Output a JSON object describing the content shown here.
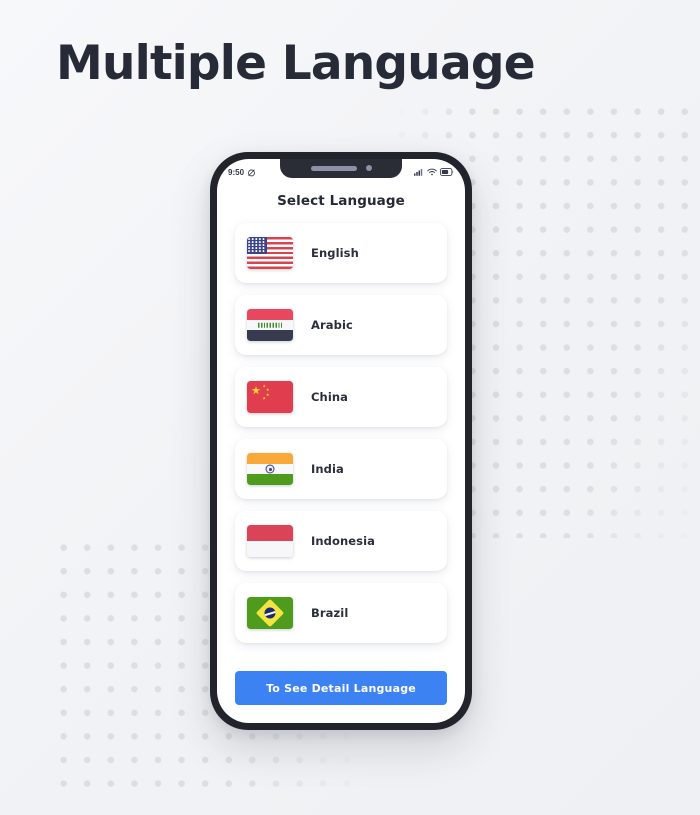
{
  "page": {
    "title": "Multiple Language",
    "background_color": "#f4f5f7",
    "dot_color": "#dcdee3"
  },
  "phone": {
    "status_bar": {
      "time": "9:50",
      "mute_icon": "alarm-off-icon",
      "signal_icon": "signal-bars-icon",
      "wifi_icon": "wifi-icon",
      "battery_icon": "battery-icon"
    },
    "screen": {
      "title": "Select Language",
      "languages": [
        {
          "label": "English",
          "flag": "flag-usa",
          "flag_name": "united-states-flag"
        },
        {
          "label": "Arabic",
          "flag": "flag-iraq",
          "flag_name": "iraq-flag"
        },
        {
          "label": "China",
          "flag": "flag-china",
          "flag_name": "china-flag"
        },
        {
          "label": "India",
          "flag": "flag-india",
          "flag_name": "india-flag"
        },
        {
          "label": "Indonesia",
          "flag": "flag-indonesia",
          "flag_name": "indonesia-flag"
        },
        {
          "label": "Brazil",
          "flag": "flag-brazil",
          "flag_name": "brazil-flag"
        }
      ],
      "detail_button": {
        "label": "To See Detail Language",
        "color": "#3d82f3",
        "text_color": "#ffffff"
      }
    }
  },
  "colors": {
    "title_text": "#272b38",
    "card_bg": "#ffffff",
    "phone_frame": "#22242c",
    "accent": "#3d82f3"
  }
}
